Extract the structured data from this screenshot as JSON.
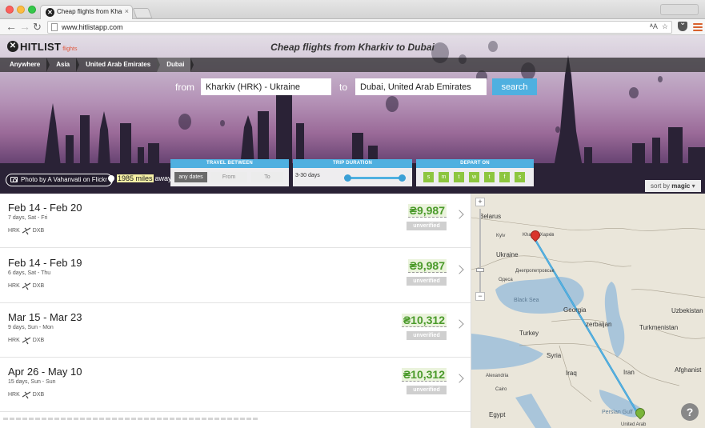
{
  "browser": {
    "tab_title": "Cheap flights from Kharkiv",
    "tab_close": "×",
    "url": "www.hitlistapp.com",
    "translate_icon": "translate-icon",
    "star_icon": "star-icon"
  },
  "site": {
    "logo_mark": "✕",
    "logo_text": "HITLIST",
    "logo_sub": "flights",
    "heading": "Cheap flights from Kharkiv to Dubai"
  },
  "breadcrumbs": [
    "Anywhere",
    "Asia",
    "United Arab Emirates",
    "Dubai"
  ],
  "search": {
    "from_label": "from",
    "from_value": "Kharkiv (HRK) - Ukraine",
    "to_label": "to",
    "to_value": "Dubai, United Arab Emirates",
    "button": "search"
  },
  "photo_credit": "Photo by A Vahanvati on Flickr",
  "distance": {
    "value": "1985 miles",
    "suffix": "away"
  },
  "filters": {
    "travel": {
      "title": "TRAVEL BETWEEN",
      "any": "any dates",
      "from": "From",
      "to": "To"
    },
    "duration": {
      "title": "TRIP DURATION",
      "label": "3-30 days",
      "range_start": 0.0,
      "range_end": 1.0
    },
    "depart": {
      "title": "DEPART ON",
      "days": [
        "s",
        "m",
        "t",
        "w",
        "t",
        "f",
        "s"
      ]
    }
  },
  "sort": {
    "prefix": "sort by",
    "value": "magic",
    "arrow": "▾"
  },
  "results": [
    {
      "dates": "Feb 14 - Feb 20",
      "meta": "7 days, Sat - Fri",
      "origin": "HRK",
      "dest": "DXB",
      "price": "₴9,987",
      "badge": "unverified"
    },
    {
      "dates": "Feb 14 - Feb 19",
      "meta": "6 days, Sat - Thu",
      "origin": "HRK",
      "dest": "DXB",
      "price": "₴9,987",
      "badge": "unverified"
    },
    {
      "dates": "Mar 15 - Mar 23",
      "meta": "9 days, Sun - Mon",
      "origin": "HRK",
      "dest": "DXB",
      "price": "₴10,312",
      "badge": "unverified"
    },
    {
      "dates": "Apr 26 - May 10",
      "meta": "15 days, Sun - Sun",
      "origin": "HRK",
      "dest": "DXB",
      "price": "₴10,312",
      "badge": "unverified"
    }
  ],
  "map": {
    "labels": {
      "belarus": "Belarus",
      "ukraine": "Ukraine",
      "kharkiv": "Kharkiv\nХарків",
      "kyiv": "Kyiv",
      "dnipro": "Днепропетровськ",
      "odesa": "Одеса",
      "black_sea": "Black Sea",
      "georgia": "Georgia",
      "azerbaijan": "zerbaijan",
      "turkmenistan": "Turkmenistan",
      "uzbekistan": "Uzbekistan",
      "turkey": "Turkey",
      "syria": "Syria",
      "iraq": "Iraq",
      "iran": "Iran",
      "afghanistan": "Afghanist",
      "alexandria": "Alexandria",
      "cairo": "Cairo",
      "egypt": "Egypt",
      "persian_gulf": "Persian Gulf",
      "uae": "United Arab"
    },
    "zoom_in": "+",
    "zoom_out": "−",
    "help": "?",
    "route_color": "#3aa0d6"
  }
}
